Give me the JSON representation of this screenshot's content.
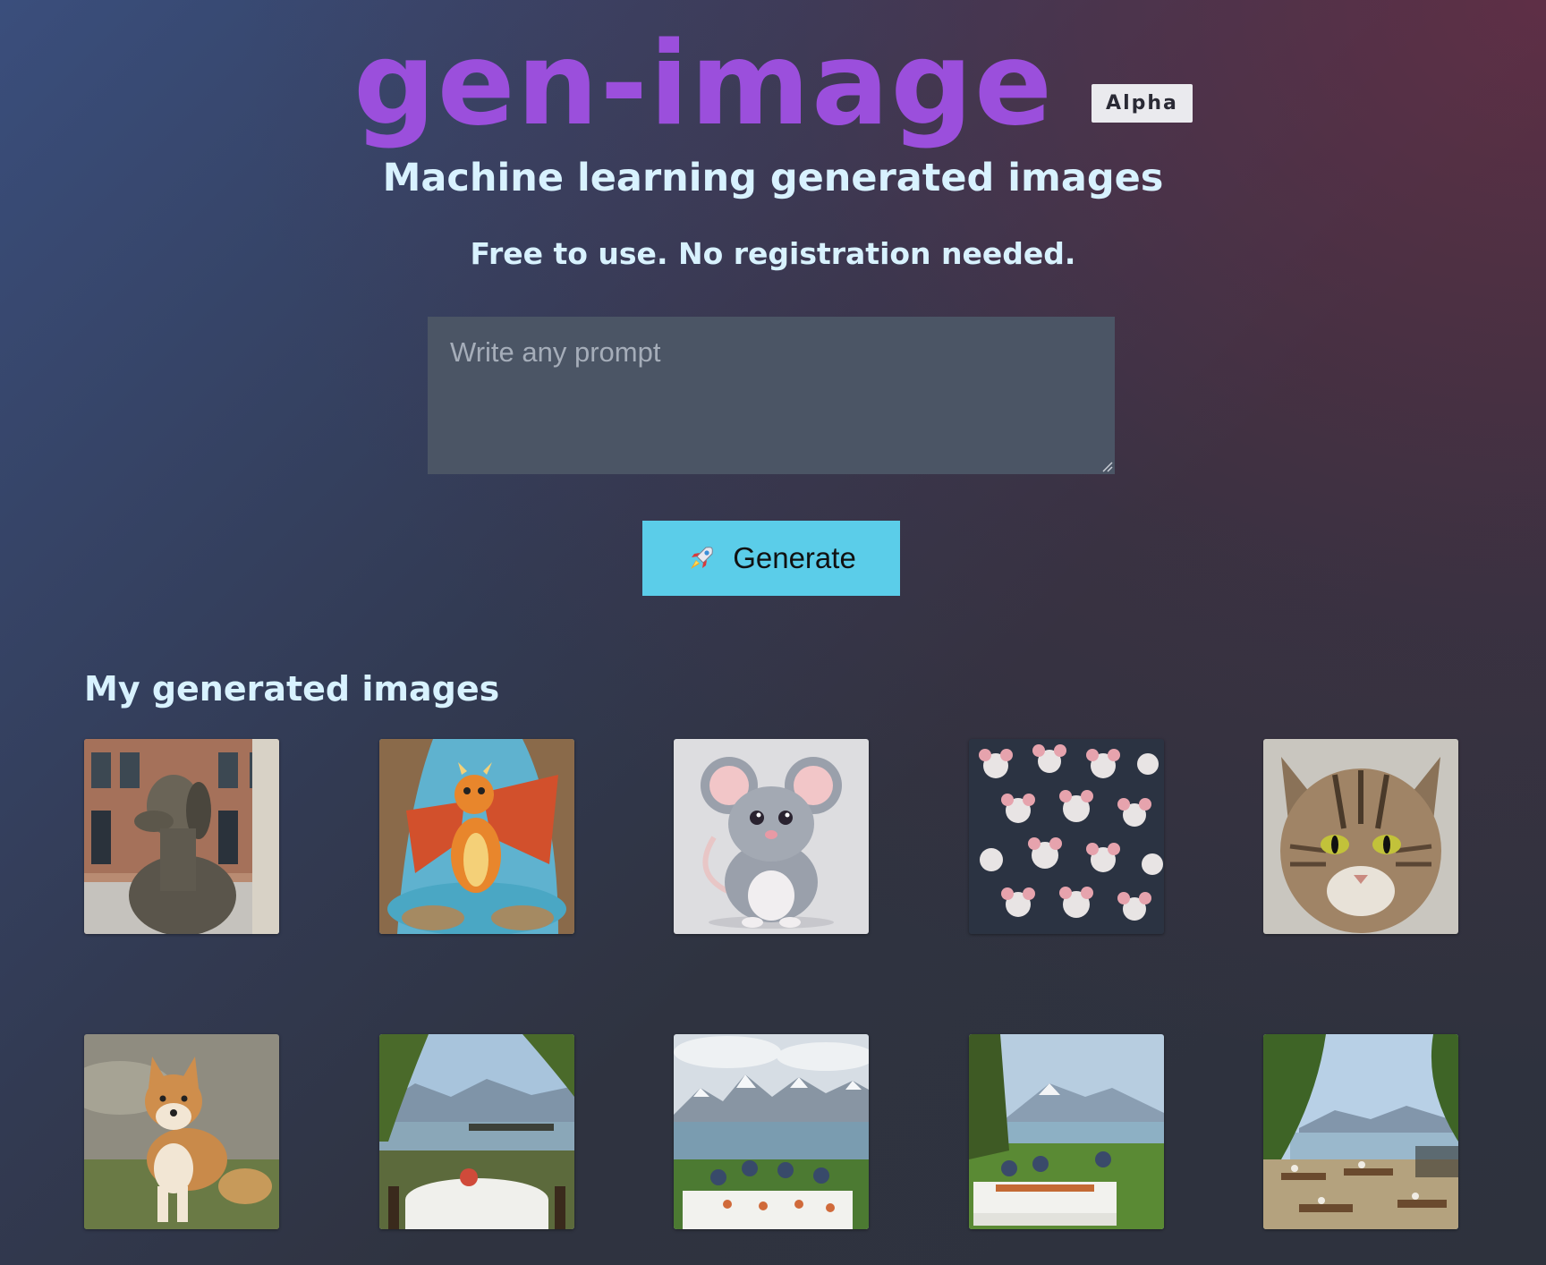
{
  "header": {
    "logo": "gen-image",
    "badge": "Alpha",
    "subtitle": "Machine learning generated images",
    "tagline": "Free to use. No registration needed."
  },
  "prompt": {
    "placeholder": "Write any prompt",
    "value": ""
  },
  "generate_button": {
    "label": "Generate",
    "icon": "rocket-icon",
    "color": "#5bcde9"
  },
  "gallery": {
    "title": "My generated images",
    "items": [
      {
        "subject": "dog-statue"
      },
      {
        "subject": "cartoon-dragon"
      },
      {
        "subject": "cartoon-mouse"
      },
      {
        "subject": "mouse-pattern"
      },
      {
        "subject": "tabby-cat"
      },
      {
        "subject": "shiba-inu"
      },
      {
        "subject": "lakeside-dinner-table"
      },
      {
        "subject": "mountain-lake-dinner-party"
      },
      {
        "subject": "lakeside-picnic"
      },
      {
        "subject": "lakeside-terrace"
      }
    ]
  },
  "colors": {
    "logo": "#9b4fdc",
    "badge_bg": "#eaeaee",
    "text": "#d8f2ff",
    "input_bg": "#4b5565"
  }
}
